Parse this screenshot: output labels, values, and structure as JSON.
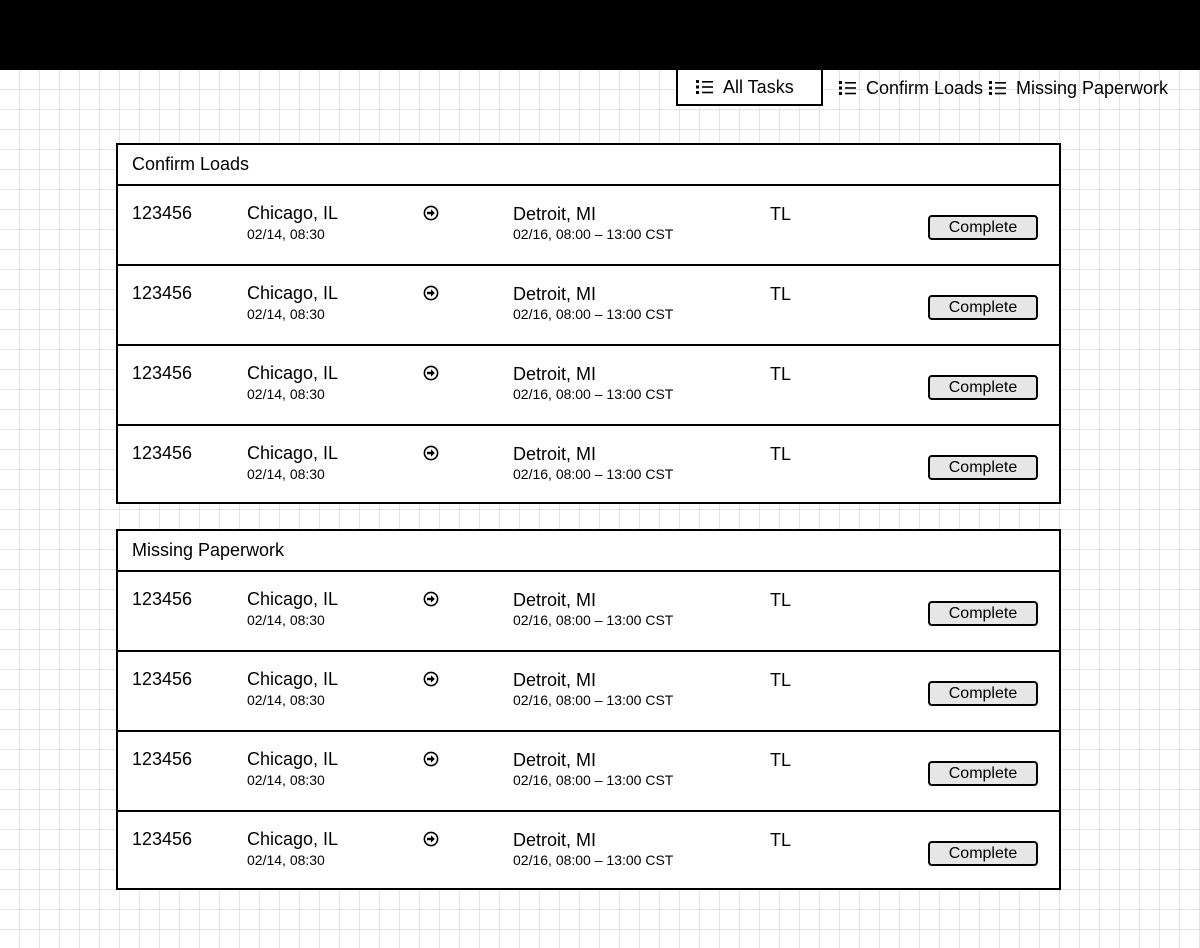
{
  "tabs": [
    {
      "label": "All Tasks",
      "icon": "list-icon",
      "active": true
    },
    {
      "label": "Confirm Loads",
      "icon": "list-icon",
      "active": false
    },
    {
      "label": "Missing Paperwork",
      "icon": "list-icon",
      "active": false
    }
  ],
  "sections": [
    {
      "title": "Confirm Loads",
      "rows": [
        {
          "load_id": "123456",
          "origin": "Chicago, IL",
          "origin_time": "02/14, 08:30",
          "arrow_icon": "arrow-right-circle-icon",
          "destination": "Detroit, MI",
          "dest_window": "02/16, 08:00 – 13:00 CST",
          "mode": "TL",
          "action": "Complete"
        },
        {
          "load_id": "123456",
          "origin": "Chicago, IL",
          "origin_time": "02/14, 08:30",
          "arrow_icon": "arrow-right-circle-icon",
          "destination": "Detroit, MI",
          "dest_window": "02/16, 08:00 – 13:00 CST",
          "mode": "TL",
          "action": "Complete"
        },
        {
          "load_id": "123456",
          "origin": "Chicago, IL",
          "origin_time": "02/14, 08:30",
          "arrow_icon": "arrow-right-circle-icon",
          "destination": "Detroit, MI",
          "dest_window": "02/16, 08:00 – 13:00 CST",
          "mode": "TL",
          "action": "Complete"
        },
        {
          "load_id": "123456",
          "origin": "Chicago, IL",
          "origin_time": "02/14, 08:30",
          "arrow_icon": "arrow-right-circle-icon",
          "destination": "Detroit, MI",
          "dest_window": "02/16, 08:00 – 13:00 CST",
          "mode": "TL",
          "action": "Complete"
        }
      ]
    },
    {
      "title": "Missing Paperwork",
      "rows": [
        {
          "load_id": "123456",
          "origin": "Chicago, IL",
          "origin_time": "02/14, 08:30",
          "arrow_icon": "arrow-right-circle-icon",
          "destination": "Detroit, MI",
          "dest_window": "02/16, 08:00 – 13:00 CST",
          "mode": "TL",
          "action": "Complete"
        },
        {
          "load_id": "123456",
          "origin": "Chicago, IL",
          "origin_time": "02/14, 08:30",
          "arrow_icon": "arrow-right-circle-icon",
          "destination": "Detroit, MI",
          "dest_window": "02/16, 08:00 – 13:00 CST",
          "mode": "TL",
          "action": "Complete"
        },
        {
          "load_id": "123456",
          "origin": "Chicago, IL",
          "origin_time": "02/14, 08:30",
          "arrow_icon": "arrow-right-circle-icon",
          "destination": "Detroit, MI",
          "dest_window": "02/16, 08:00 – 13:00 CST",
          "mode": "TL",
          "action": "Complete"
        },
        {
          "load_id": "123456",
          "origin": "Chicago, IL",
          "origin_time": "02/14, 08:30",
          "arrow_icon": "arrow-right-circle-icon",
          "destination": "Detroit, MI",
          "dest_window": "02/16, 08:00 – 13:00 CST",
          "mode": "TL",
          "action": "Complete"
        }
      ]
    }
  ]
}
